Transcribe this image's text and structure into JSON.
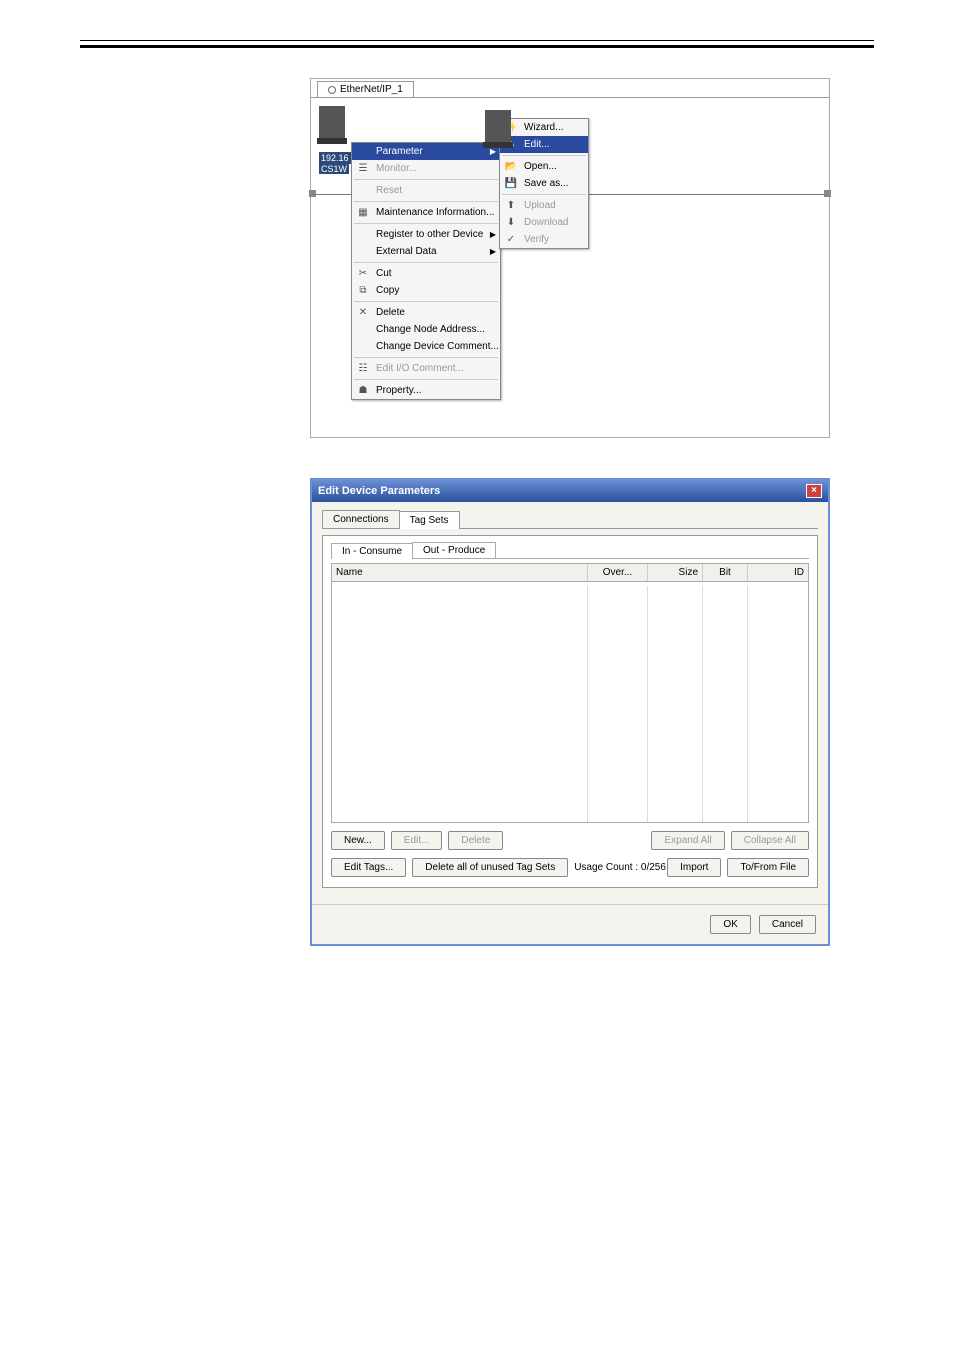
{
  "network_tab": "EtherNet/IP_1",
  "ip_top": "192.16",
  "ip_bottom": "CS1W",
  "ctx_menu": {
    "parameter": "Parameter",
    "monitor": "Monitor...",
    "reset": "Reset",
    "maint": "Maintenance Information...",
    "register": "Register to other Device",
    "external": "External Data",
    "cut": "Cut",
    "copy": "Copy",
    "delete": "Delete",
    "change_addr": "Change Node Address...",
    "change_comment": "Change Device Comment...",
    "edit_io": "Edit I/O Comment...",
    "property": "Property..."
  },
  "submenu": {
    "wizard": "Wizard...",
    "edit": "Edit...",
    "open": "Open...",
    "saveas": "Save as...",
    "upload": "Upload",
    "download": "Download",
    "verify": "Verify"
  },
  "dialog": {
    "title": "Edit Device Parameters",
    "tabs": {
      "connections": "Connections",
      "tagsets": "Tag Sets"
    },
    "subtabs": {
      "in": "In - Consume",
      "out": "Out - Produce"
    },
    "cols": {
      "name": "Name",
      "over": "Over...",
      "size": "Size",
      "bit": "Bit",
      "id": "ID"
    },
    "btn_new": "New...",
    "btn_edit": "Edit...",
    "btn_delete": "Delete",
    "btn_expand": "Expand All",
    "btn_collapse": "Collapse All",
    "btn_edittags": "Edit Tags...",
    "btn_delall": "Delete all of unused Tag Sets",
    "usage": "Usage Count :  0/256",
    "btn_import": "Import",
    "btn_tofrom": "To/From File",
    "btn_ok": "OK",
    "btn_cancel": "Cancel"
  }
}
